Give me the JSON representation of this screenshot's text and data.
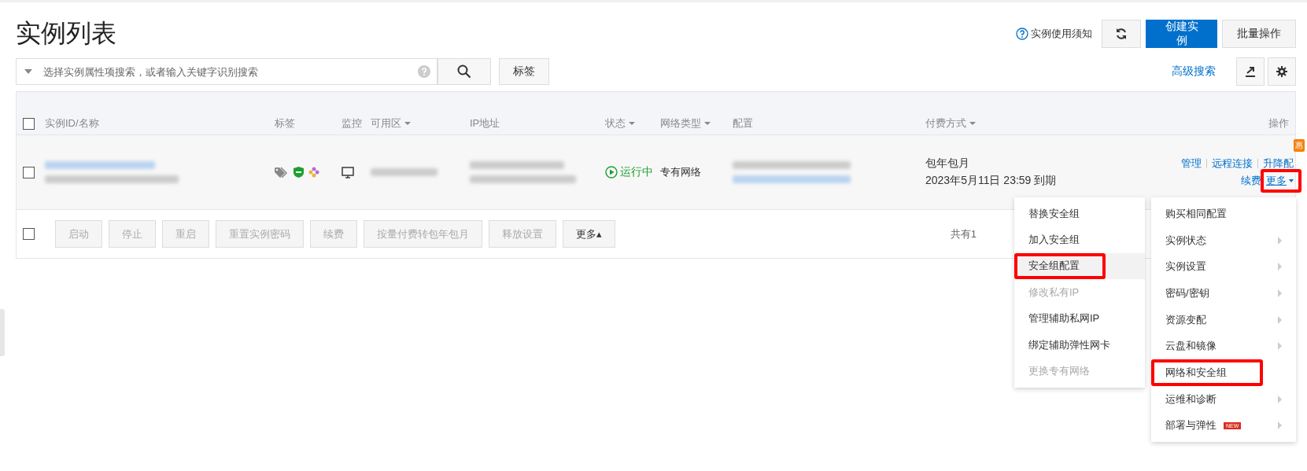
{
  "page": {
    "title": "实例列表",
    "notice_link": "实例使用须知",
    "create_button": "创建实例",
    "batch_button": "批量操作"
  },
  "search": {
    "placeholder": "选择实例属性项搜索，或者输入关键字识别搜索",
    "tag_button": "标签",
    "advanced_link": "高级搜索"
  },
  "table": {
    "columns": [
      {
        "label": "实例ID/名称",
        "sortable": false
      },
      {
        "label": "标签",
        "sortable": false
      },
      {
        "label": "监控",
        "sortable": false
      },
      {
        "label": "可用区",
        "sortable": true
      },
      {
        "label": "IP地址",
        "sortable": false
      },
      {
        "label": "状态",
        "sortable": true
      },
      {
        "label": "网络类型",
        "sortable": true
      },
      {
        "label": "配置",
        "sortable": false
      },
      {
        "label": "付费方式",
        "sortable": true
      },
      {
        "label": "操作",
        "sortable": false
      }
    ],
    "select_all_checked": false,
    "rows": [
      {
        "checked": false,
        "status": "运行中",
        "running": true,
        "network": "专有网络",
        "billing": "包年包月",
        "expiry": "2023年5月11日 23:59 到期",
        "badge": "惠",
        "action_rows": [
          [
            {
              "label": "管理",
              "highlighted": false
            },
            {
              "label": "远程连接",
              "highlighted": false
            },
            {
              "label": "升降配",
              "highlighted": false
            }
          ],
          [
            {
              "label": "续费",
              "highlighted": false
            },
            {
              "label": "更多",
              "highlighted": true,
              "dropdown": true
            }
          ]
        ]
      }
    ]
  },
  "bulk_bar": {
    "checked": false,
    "buttons": [
      {
        "label": "启动",
        "disabled": true
      },
      {
        "label": "停止",
        "disabled": true
      },
      {
        "label": "重启",
        "disabled": true
      },
      {
        "label": "重置实例密码",
        "disabled": true
      },
      {
        "label": "续费",
        "disabled": true
      },
      {
        "label": "按量付费转包年包月",
        "disabled": true
      },
      {
        "label": "释放设置",
        "disabled": true
      },
      {
        "label": "更多▴",
        "disabled": false
      }
    ],
    "total": "共有1"
  },
  "submenu": {
    "items": [
      {
        "label": "替换安全组",
        "disabled": false,
        "hovered": false,
        "highlighted": false
      },
      {
        "label": "加入安全组",
        "disabled": false,
        "hovered": false,
        "highlighted": false
      },
      {
        "label": "安全组配置",
        "disabled": false,
        "hovered": true,
        "highlighted": true
      },
      {
        "label": "修改私有IP",
        "disabled": true,
        "hovered": false,
        "highlighted": false
      },
      {
        "label": "管理辅助私网IP",
        "disabled": false,
        "hovered": false,
        "highlighted": false
      },
      {
        "label": "绑定辅助弹性网卡",
        "disabled": false,
        "hovered": false,
        "highlighted": false
      },
      {
        "label": "更换专有网络",
        "disabled": true,
        "hovered": false,
        "highlighted": false
      }
    ]
  },
  "menu": {
    "items": [
      {
        "label": "购买相同配置",
        "has_submenu": false,
        "highlighted": false
      },
      {
        "label": "实例状态",
        "has_submenu": true,
        "highlighted": false
      },
      {
        "label": "实例设置",
        "has_submenu": true,
        "highlighted": false
      },
      {
        "label": "密码/密钥",
        "has_submenu": true,
        "highlighted": false
      },
      {
        "label": "资源变配",
        "has_submenu": true,
        "highlighted": false
      },
      {
        "label": "云盘和镜像",
        "has_submenu": true,
        "highlighted": false
      },
      {
        "label": "网络和安全组",
        "has_submenu": false,
        "highlighted": true
      },
      {
        "label": "运维和诊断",
        "has_submenu": true,
        "highlighted": false
      },
      {
        "label": "部署与弹性",
        "has_submenu": true,
        "highlighted": false,
        "badge": "NEW"
      }
    ]
  }
}
